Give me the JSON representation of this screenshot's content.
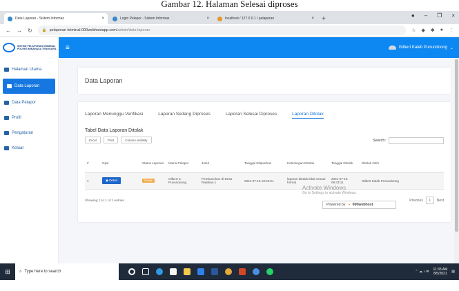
{
  "caption": "Gambar 12. Halaman Selesai diproses",
  "browser": {
    "tabs": [
      {
        "title": "Data Laporan - Sistem Informas",
        "active": true
      },
      {
        "title": "Login Pelapor - Sistem Informas",
        "active": false
      },
      {
        "title": "localhost / 127.0.0.1 / pelaporan",
        "active": false
      }
    ],
    "url_domain": "pelaporan kriminal.000webhostapp.com",
    "url_path": "/admin/data laporan"
  },
  "header": {
    "brand_line1": "SISTEM PELAPORAN KRIMINAL",
    "brand_line2": "POLRES MINAHASA TENGGARA",
    "user_name": "Gilbert Kaleb Punundoong"
  },
  "sidebar": {
    "items": [
      {
        "label": "Halaman Utama",
        "icon": "home-icon",
        "active": false
      },
      {
        "label": "Data Laporan",
        "icon": "report-icon",
        "active": true
      },
      {
        "label": "Data Pelapor",
        "icon": "users-icon",
        "active": false
      },
      {
        "label": "Profil",
        "icon": "user-icon",
        "active": false
      },
      {
        "label": "Pengaturan",
        "icon": "gear-icon",
        "active": false
      },
      {
        "label": "Keluar",
        "icon": "logout-icon",
        "active": false
      }
    ]
  },
  "page": {
    "title": "Data Laporan",
    "tabs": [
      "Laporan Menunggu Verifikasi",
      "Laporan Sedang Diproses",
      "Laporan Selesai Diproses",
      "Laporan Ditolak"
    ],
    "active_tab": 3,
    "table_title": "Tabel Data Laporan Ditolak",
    "buttons": [
      "Excel",
      "Print",
      "Column visibility"
    ],
    "search_label": "Search:",
    "columns": [
      "#",
      "Opsi",
      "Status Laporan",
      "Nama Pelapor",
      "Judul",
      "Tanggal Dilaporkan",
      "Keterangan Ditolak",
      "Tanggal Ditolak",
      "Ditolak Oleh"
    ],
    "rows": [
      {
        "no": "1",
        "opsi": "Detail",
        "status": "Ditolak",
        "nama": "Gilbert K. Punundoong",
        "judul": "Pembunuhan di Desa Ratahan 1",
        "tanggal": "2021-07-15 19:22:21",
        "keterangan": "laporan ditolak tidak sesuai format",
        "tgl_ditolak": "2021-07-16 09:43:11",
        "oleh": "Gilbert Kaleb Punundoong"
      }
    ],
    "info": "Showing 1 to 1 of 1 entries",
    "pager": {
      "prev": "Previous",
      "page": "1",
      "next": "Next"
    }
  },
  "overlay": {
    "activate_title": "Activate Windows",
    "activate_sub": "Go to Settings to activate Windows.",
    "powered": "Powered by",
    "powered_brand": "000webhost"
  },
  "taskbar": {
    "search_placeholder": "Type here to search",
    "time": "11:33 AM",
    "date": "8/5/2021"
  }
}
